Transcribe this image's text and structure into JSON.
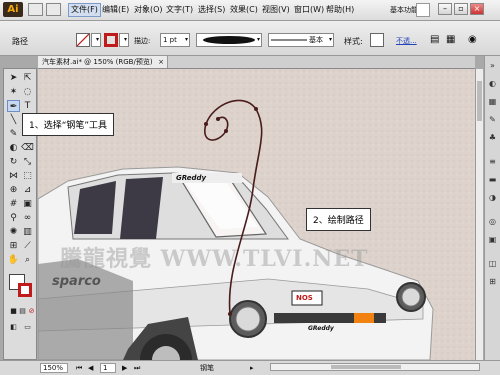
{
  "app": {
    "logo_text": "Ai"
  },
  "menubar": {
    "items": [
      "文件(F)",
      "编辑(E)",
      "对象(O)",
      "文字(T)",
      "选择(S)",
      "效果(C)",
      "视图(V)",
      "窗口(W)",
      "帮助(H)"
    ],
    "workspace": "基本功能"
  },
  "controlbar": {
    "title": "路径",
    "opacity_label": "描边:",
    "stroke_weight": "1 pt",
    "brush_label": "基本",
    "style_label": "样式:",
    "transparency_link": "不透..."
  },
  "document": {
    "tab_title": "汽车素材.ai* @ 150% (RGB/预览)"
  },
  "statusbar": {
    "zoom": "150%",
    "page": "1",
    "tool_name": "钢笔"
  },
  "callouts": {
    "step1": "1、选择“钢笔”工具",
    "step2": "2、绘制路径"
  },
  "watermark": "騰龍視覺 WWW.TLVI.NET",
  "car": {
    "hood_brand": "NOS",
    "windshield_brand": "GReddy",
    "grille_brand": "GReddy",
    "door_brand": "sparco"
  },
  "colors": {
    "stroke": "#c01a1a",
    "accent": "#f7a70a",
    "canvas": "#ddd3cc"
  }
}
